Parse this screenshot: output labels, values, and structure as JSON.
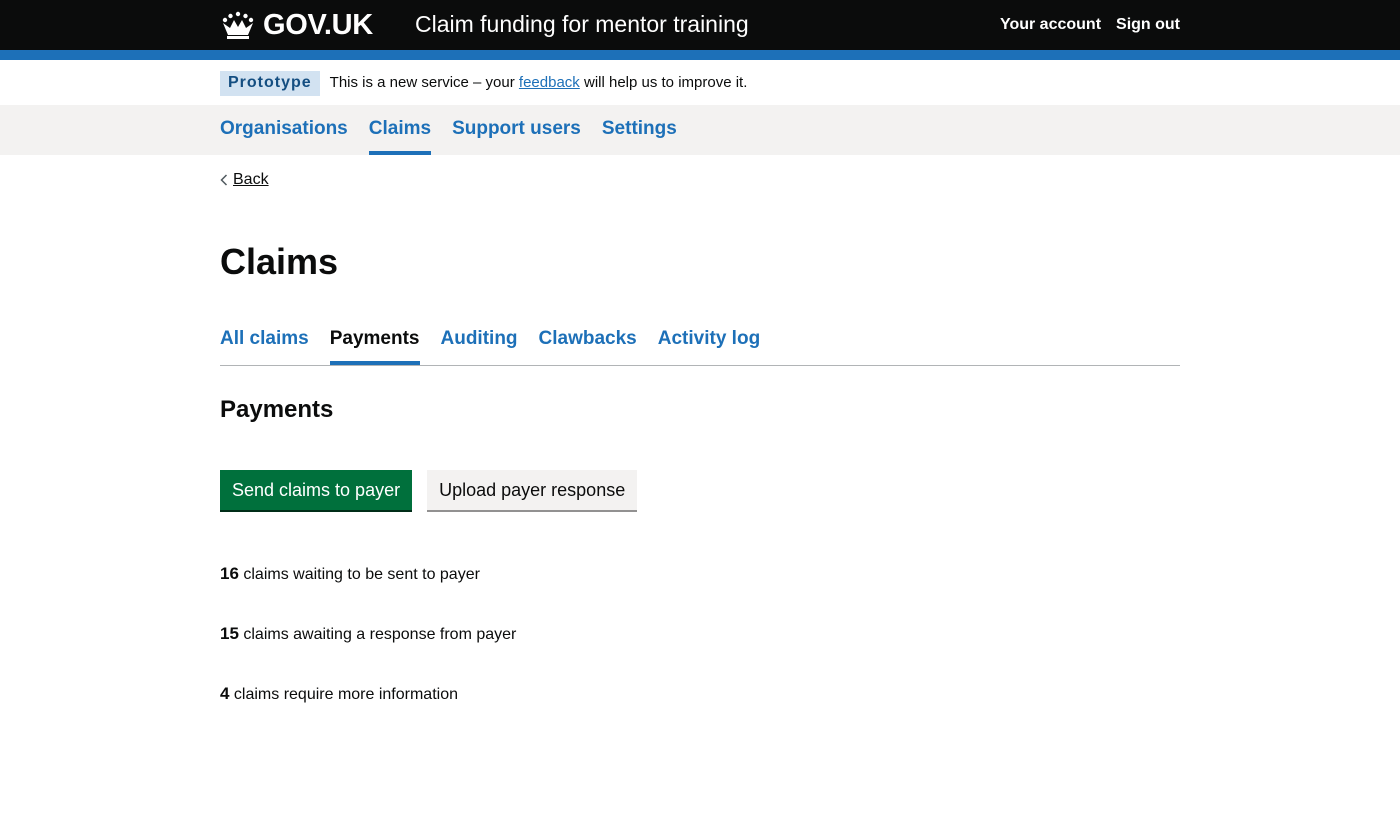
{
  "header": {
    "logo_text": "GOV.UK",
    "service_name": "Claim funding for mentor training",
    "links": [
      "Your account",
      "Sign out"
    ]
  },
  "phase_banner": {
    "tag": "Prototype",
    "text_before": "This is a new service – your ",
    "link_text": "feedback",
    "text_after": " will help us to improve it."
  },
  "primary_nav": {
    "items": [
      "Organisations",
      "Claims",
      "Support users",
      "Settings"
    ],
    "active": "Claims"
  },
  "back_link": "Back",
  "page_title": "Claims",
  "sub_nav": {
    "items": [
      "All claims",
      "Payments",
      "Auditing",
      "Clawbacks",
      "Activity log"
    ],
    "active": "Payments"
  },
  "section_heading": "Payments",
  "buttons": {
    "send": "Send claims to payer",
    "upload": "Upload payer response"
  },
  "stats": [
    {
      "count": "16",
      "text": " claims waiting to be sent to payer"
    },
    {
      "count": "15",
      "text": " claims awaiting a response from payer"
    },
    {
      "count": "4",
      "text": " claims require more information"
    }
  ],
  "colors": {
    "header_bg": "#0b0c0c",
    "brand_blue": "#1d70b8",
    "primary_button": "#00703c",
    "phase_tag_bg": "#d2e2f1",
    "nav_bg": "#f3f2f1"
  },
  "icons": [
    "crown-icon",
    "chevron-left-icon"
  ]
}
